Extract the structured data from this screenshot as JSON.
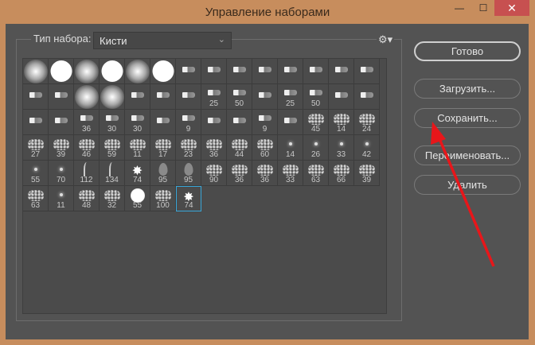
{
  "window": {
    "title": "Управление наборами",
    "minimize": "—",
    "maximize": "☐",
    "close": "✕"
  },
  "preset_type": {
    "label": "Тип набора:",
    "value": "Кисти",
    "chevron": "⌄",
    "gear": "⚙▾"
  },
  "buttons": {
    "done": "Готово",
    "load": "Загрузить...",
    "save": "Сохранить...",
    "rename": "Переименовать...",
    "delete": "Удалить"
  },
  "accent_color": "#38a6d8",
  "annotation_arrow_color": "#e8161a",
  "brushes": [
    {
      "k": "soft"
    },
    {
      "k": "hard"
    },
    {
      "k": "soft"
    },
    {
      "k": "hard"
    },
    {
      "k": "soft"
    },
    {
      "k": "hard"
    },
    {
      "k": "tip"
    },
    {
      "k": "tip"
    },
    {
      "k": "tip"
    },
    {
      "k": "tip"
    },
    {
      "k": "tip"
    },
    {
      "k": "tip"
    },
    {
      "k": "tip"
    },
    {
      "k": "tip"
    },
    {
      "k": "tip"
    },
    {
      "k": "tip"
    },
    {
      "k": "soft"
    },
    {
      "k": "soft"
    },
    {
      "k": "tip"
    },
    {
      "k": "tip"
    },
    {
      "k": "tip"
    },
    {
      "k": "tip",
      "n": "25"
    },
    {
      "k": "tip",
      "n": "50"
    },
    {
      "k": "tip"
    },
    {
      "k": "tip",
      "n": "25"
    },
    {
      "k": "tip",
      "n": "50"
    },
    {
      "k": "tip"
    },
    {
      "k": "tip"
    },
    {
      "k": "tip"
    },
    {
      "k": "tip"
    },
    {
      "k": "tip",
      "n": "36"
    },
    {
      "k": "tip",
      "n": "30"
    },
    {
      "k": "tip",
      "n": "30"
    },
    {
      "k": "tip"
    },
    {
      "k": "tip",
      "n": "9"
    },
    {
      "k": "tip"
    },
    {
      "k": "tip"
    },
    {
      "k": "tip",
      "n": "9"
    },
    {
      "k": "tip"
    },
    {
      "k": "splat",
      "n": "45"
    },
    {
      "k": "splat",
      "n": "14"
    },
    {
      "k": "splat",
      "n": "24"
    },
    {
      "k": "splat",
      "n": "27"
    },
    {
      "k": "splat",
      "n": "39"
    },
    {
      "k": "splat",
      "n": "46"
    },
    {
      "k": "splat",
      "n": "59"
    },
    {
      "k": "splat",
      "n": "11"
    },
    {
      "k": "splat",
      "n": "17"
    },
    {
      "k": "splat",
      "n": "23"
    },
    {
      "k": "splat",
      "n": "36"
    },
    {
      "k": "splat",
      "n": "44"
    },
    {
      "k": "splat",
      "n": "60"
    },
    {
      "k": "star",
      "n": "14"
    },
    {
      "k": "star",
      "n": "26"
    },
    {
      "k": "star",
      "n": "33"
    },
    {
      "k": "star",
      "n": "42"
    },
    {
      "k": "star",
      "n": "55"
    },
    {
      "k": "star",
      "n": "70"
    },
    {
      "k": "grass",
      "n": "112"
    },
    {
      "k": "grass",
      "n": "134"
    },
    {
      "k": "leaf",
      "n": "74"
    },
    {
      "k": "leafg",
      "n": "95"
    },
    {
      "k": "leafg",
      "n": "95"
    },
    {
      "k": "splat",
      "n": "90"
    },
    {
      "k": "splat",
      "n": "36"
    },
    {
      "k": "splat",
      "n": "36"
    },
    {
      "k": "splat",
      "n": "33"
    },
    {
      "k": "splat",
      "n": "63"
    },
    {
      "k": "splat",
      "n": "66"
    },
    {
      "k": "splat",
      "n": "39"
    },
    {
      "k": "splat",
      "n": "63"
    },
    {
      "k": "star",
      "n": "11"
    },
    {
      "k": "splat",
      "n": "48"
    },
    {
      "k": "splat",
      "n": "32"
    },
    {
      "k": "round",
      "n": "55"
    },
    {
      "k": "splat",
      "n": "100"
    },
    {
      "k": "leaf",
      "n": "74",
      "selected": true
    }
  ]
}
